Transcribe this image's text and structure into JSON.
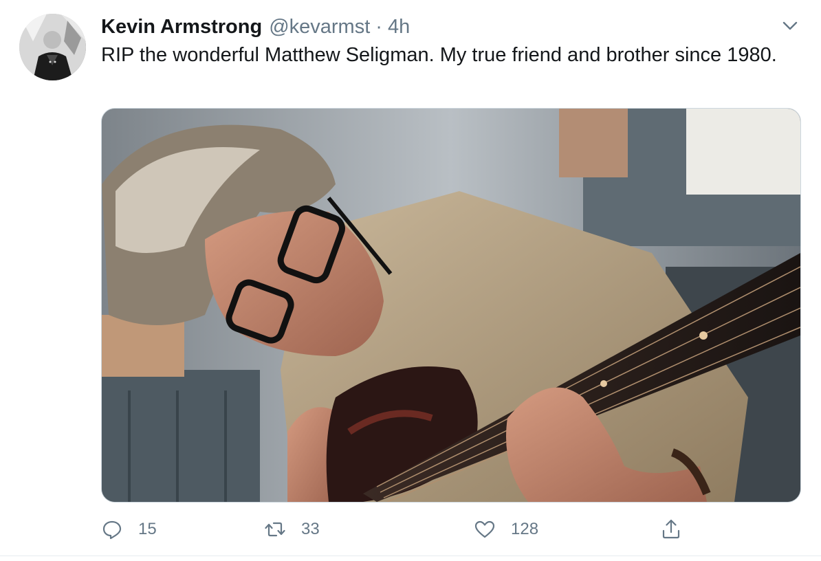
{
  "tweet": {
    "author": {
      "display_name": "Kevin Armstrong",
      "handle": "@kevarmst",
      "separator": "·",
      "time": "4h",
      "avatar_icon": "profile-photo"
    },
    "menu_icon": "chevron-down-icon",
    "text": "RIP the wonderful Matthew Seligman. My true friend and brother since 1980.",
    "media": {
      "type": "photo"
    },
    "actions": {
      "reply": {
        "icon": "reply-icon",
        "count": "15"
      },
      "retweet": {
        "icon": "retweet-icon",
        "count": "33"
      },
      "like": {
        "icon": "heart-icon",
        "count": "128"
      },
      "share": {
        "icon": "share-icon"
      }
    }
  },
  "colors": {
    "text_primary": "#14171a",
    "text_secondary": "#657786",
    "border": "#e6ecf0"
  }
}
